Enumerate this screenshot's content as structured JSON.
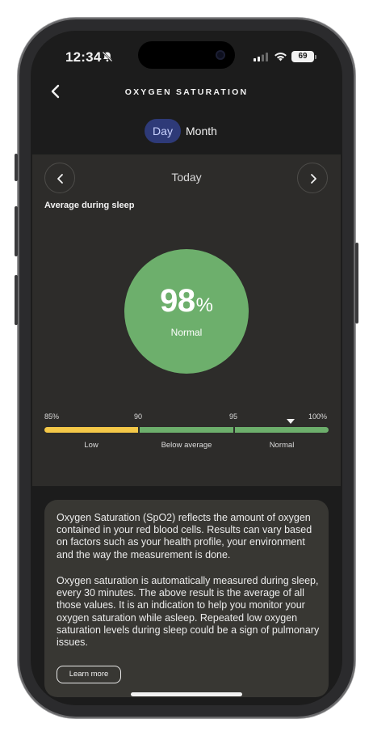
{
  "status_bar": {
    "time": "12:34",
    "battery": "69"
  },
  "header": {
    "title": "OXYGEN SATURATION"
  },
  "tabs": [
    {
      "label": "Day",
      "active": true
    },
    {
      "label": "Month",
      "active": false
    }
  ],
  "day_card": {
    "period_label": "Today",
    "section_label": "Average during sleep",
    "value": "98",
    "unit": "%",
    "status": "Normal",
    "scale": {
      "ticks": [
        "85%",
        "90",
        "95",
        "100%"
      ],
      "categories": [
        "Low",
        "Below average",
        "Normal"
      ],
      "marker_percent": 98
    }
  },
  "info": {
    "paragraph_1": "Oxygen Saturation (SpO2) reflects the amount of oxygen contained in your red blood cells. Results can vary based on factors such as your health profile, your environment and the way the measurement is done.",
    "paragraph_2": "Oxygen saturation is automatically measured during sleep, every 30 minutes. The above result is the average of all those values. It is an indication to help you monitor your oxygen saturation while asleep. Repeated low oxygen saturation levels during sleep could be a sign of pulmonary issues.",
    "learn_more_label": "Learn more"
  },
  "colors": {
    "accent_tab": "#2e3a78",
    "good": "#6daf6c",
    "low": "#f4c848",
    "card_bg": "#2d2c2a",
    "info_bg": "#383733"
  },
  "icons": {
    "back": "chevron-left-icon",
    "prev": "chevron-left-icon",
    "next": "chevron-right-icon",
    "bell": "bell-slash-icon",
    "signal": "cellular-signal-icon",
    "wifi": "wifi-icon",
    "battery": "battery-icon"
  }
}
